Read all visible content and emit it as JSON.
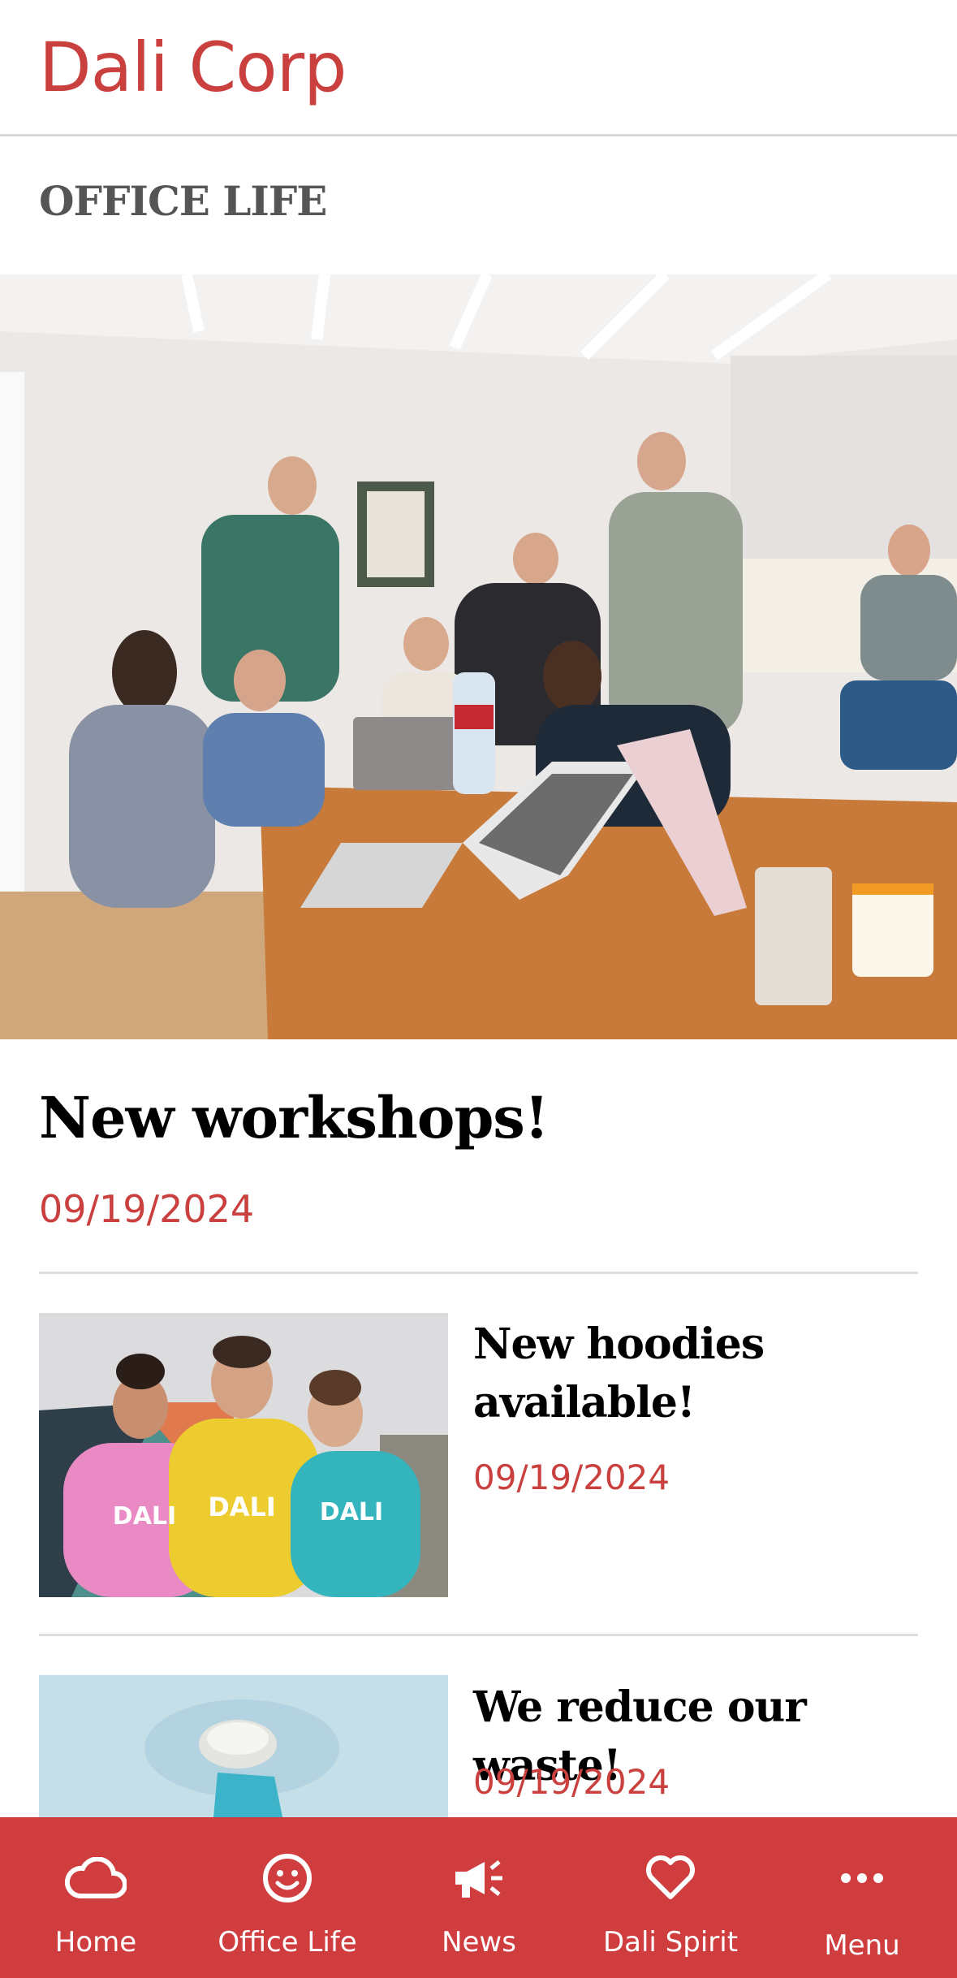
{
  "header": {
    "title": "Dali Corp"
  },
  "section": {
    "title": "OFFICE LIFE"
  },
  "featured": {
    "title": "New workshops!",
    "date": "09/19/2024"
  },
  "articles": [
    {
      "title": "New hoodies available!",
      "date": "09/19/2024"
    },
    {
      "title": "We reduce our waste!",
      "date": "09/19/2024"
    }
  ],
  "tabbar": {
    "items": [
      {
        "label": "Home",
        "icon": "cloud-icon"
      },
      {
        "label": "Office Life",
        "icon": "smiley-icon"
      },
      {
        "label": "News",
        "icon": "megaphone-icon"
      },
      {
        "label": "Dali Spirit",
        "icon": "heart-icon"
      },
      {
        "label": "Menu",
        "icon": "more-icon"
      }
    ]
  },
  "colors": {
    "brand": "#c9403e",
    "tabbar": "#cf3d3f"
  }
}
